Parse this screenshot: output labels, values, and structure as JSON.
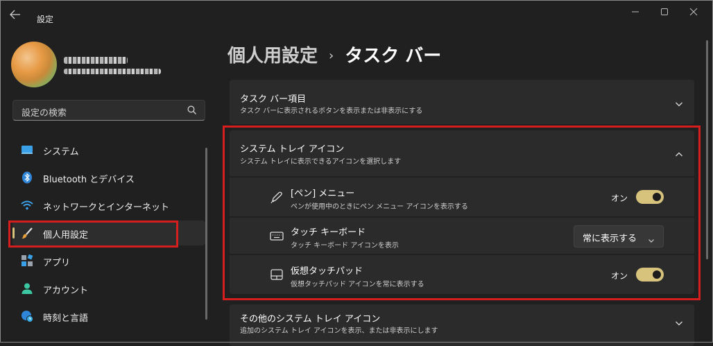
{
  "window": {
    "title": "設定"
  },
  "user": {
    "name": "",
    "email": ""
  },
  "search": {
    "placeholder": "設定の検索"
  },
  "sidebar": {
    "items": [
      {
        "label": "システム",
        "icon": "system-icon"
      },
      {
        "label": "Bluetooth とデバイス",
        "icon": "bluetooth-icon"
      },
      {
        "label": "ネットワークとインターネット",
        "icon": "wifi-icon"
      },
      {
        "label": "個人用設定",
        "icon": "paint-brush-icon",
        "selected": true
      },
      {
        "label": "アプリ",
        "icon": "apps-icon"
      },
      {
        "label": "アカウント",
        "icon": "account-icon"
      },
      {
        "label": "時刻と言語",
        "icon": "time-language-icon"
      }
    ]
  },
  "breadcrumb": {
    "parent": "個人用設定",
    "separator": "›",
    "current": "タスク バー"
  },
  "sections": {
    "taskbar_items": {
      "title": "タスク バー項目",
      "desc": "タスク バーに表示されるボタンを表示または非表示にする",
      "expanded": false
    },
    "tray_icons": {
      "title": "システム トレイ アイコン",
      "desc": "システム トレイに表示できるアイコンを選択します",
      "expanded": true
    },
    "other_tray": {
      "title": "その他のシステム トレイ アイコン",
      "desc": "追加のシステム トレイ アイコンを表示、または非表示にします",
      "expanded": false
    }
  },
  "tray_settings": {
    "pen": {
      "title": "[ペン] メニュー",
      "desc": "ペンが使用中のときにペン メニュー アイコンを表示する",
      "state_label": "オン",
      "on": true
    },
    "touch_keyboard": {
      "title": "タッチ キーボード",
      "desc": "タッチ キーボード アイコンを表示",
      "selected": "常に表示する"
    },
    "touchpad": {
      "title": "仮想タッチパッド",
      "desc": "仮想タッチパッド アイコンを常に表示する",
      "state_label": "オン",
      "on": true
    }
  },
  "colors": {
    "accent": "#d8c37c",
    "highlight_box": "#d71e1e",
    "background": "#202020",
    "card": "#2b2b2b"
  }
}
